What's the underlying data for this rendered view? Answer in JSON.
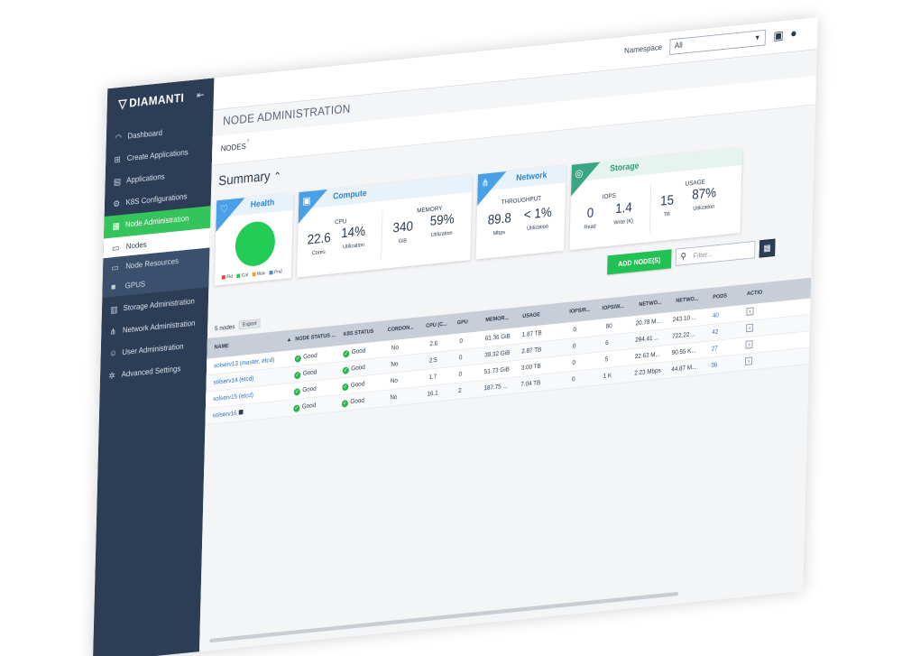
{
  "topbar": {
    "namespace_label": "Namespace",
    "namespace_value": "All",
    "icons": [
      "calendar-icon",
      "user-icon"
    ]
  },
  "sidebar": {
    "logo": "DIAMANTI",
    "items": [
      {
        "label": "Dashboard",
        "icon": "dashboard-icon"
      },
      {
        "label": "Create Applications",
        "icon": "plus-square-icon"
      },
      {
        "label": "Applications",
        "icon": "apps-icon"
      },
      {
        "label": "K8S Configurations",
        "icon": "gear-icon"
      },
      {
        "label": "Node Administration",
        "icon": "node-icon"
      },
      {
        "label": "Nodes",
        "icon": "monitor-icon"
      },
      {
        "label": "Node Resources",
        "icon": "monitor-icon"
      },
      {
        "label": "GPUS",
        "icon": "gpu-icon"
      },
      {
        "label": "Storage Administration",
        "icon": "database-icon"
      },
      {
        "label": "Network Administration",
        "icon": "network-icon"
      },
      {
        "label": "User Administration",
        "icon": "users-icon"
      },
      {
        "label": "Advanced Settings",
        "icon": "settings-icon"
      }
    ]
  },
  "main": {
    "page_title": "NODE ADMINISTRATION",
    "nodes_title": "NODES",
    "summary_title": "Summary",
    "cards": {
      "health": {
        "title": "Health",
        "legend": [
          "Fld",
          "Cal",
          "Wav",
          "Pnd"
        ],
        "legend_colors": [
          "#e04646",
          "#22cc55",
          "#f0a030",
          "#3b8de0"
        ]
      },
      "compute": {
        "title": "Compute",
        "cpu_label": "CPU",
        "cpu_cores": "22.6",
        "cpu_cores_unit": "Cores",
        "cpu_util": "14%",
        "cpu_util_unit": "Utilization",
        "mem_label": "MEMORY",
        "mem_value": "340",
        "mem_unit": "GiB",
        "mem_util": "59%",
        "mem_util_unit": "Utilization"
      },
      "network": {
        "title": "Network",
        "throughput_label": "THROUGHPUT",
        "throughput": "89.8",
        "throughput_unit": "Mbps",
        "util": "< 1%",
        "util_unit": "Utilization"
      },
      "storage": {
        "title": "Storage",
        "iops_label": "IOPS",
        "read": "0",
        "read_unit": "Read",
        "write": "1.4",
        "write_unit": "Write (K)",
        "usage_label": "USAGE",
        "usage_tb": "15",
        "usage_tb_unit": "TB",
        "usage_util": "87%",
        "usage_util_unit": "Utilization"
      }
    },
    "add_button": "ADD NODE(S)",
    "filter_placeholder": "Filter...",
    "node_count": "5 nodes",
    "export_label": "Export",
    "columns": [
      "NAME",
      "NODE STATUS ...",
      "K8S STATUS",
      "CORDON...",
      "CPU (C...",
      "GPU",
      "MEMOR...",
      "USAGE",
      "IOPS/R...",
      "IOPS/W...",
      "NETWO...",
      "NETWO...",
      "PODS",
      "ACTIO"
    ],
    "rows": [
      {
        "name": "solserv13 (master, etcd)",
        "node_status": "Good",
        "k8s_status": "Good",
        "cordon": "No",
        "cpu": "2.6",
        "gpu": "0",
        "memory": "61.36 GiB",
        "usage": "1.87 TB",
        "iops_r": "0",
        "iops_w": "80",
        "net_rx": "20.78 M...",
        "net_tx": "243.10 ...",
        "pods": "40"
      },
      {
        "name": "solserv14 (etcd)",
        "node_status": "Good",
        "k8s_status": "Good",
        "cordon": "No",
        "cpu": "2.5",
        "gpu": "0",
        "memory": "39.32 GiB",
        "usage": "2.87 TB",
        "iops_r": "0",
        "iops_w": "6",
        "net_rx": "294.41 ...",
        "net_tx": "722.22 ...",
        "pods": "42"
      },
      {
        "name": "solserv15 (etcd)",
        "node_status": "Good",
        "k8s_status": "Good",
        "cordon": "No",
        "cpu": "1.7",
        "gpu": "0",
        "memory": "51.73 GiB",
        "usage": "3.00 TB",
        "iops_r": "0",
        "iops_w": "5",
        "net_rx": "22.63 M...",
        "net_tx": "90.55 K...",
        "pods": "27"
      },
      {
        "name": "solserv16",
        "node_status": "Good",
        "k8s_status": "Good",
        "cordon": "No",
        "cpu": "16.1",
        "gpu": "2",
        "memory": "187.75 ...",
        "usage": "7.04 TB",
        "iops_r": "0",
        "iops_w": "1 K",
        "net_rx": "2.23 Mbps",
        "net_tx": "44.87 M...",
        "pods": "36"
      }
    ]
  }
}
